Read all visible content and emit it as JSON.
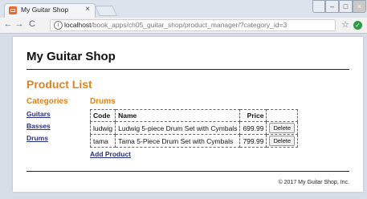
{
  "browser": {
    "tab_title": "My Guitar Shop",
    "tab_close": "×",
    "back": "←",
    "forward": "→",
    "reload": "C",
    "url_host": "localhost",
    "url_path": "/book_apps/ch05_guitar_shop/product_manager/?category_id=3",
    "star": "☆",
    "ext": "✓",
    "menu": "⋮",
    "win_min": "–",
    "win_max": "□",
    "win_close": "×"
  },
  "site": {
    "title": "My Guitar Shop",
    "footer": "© 2017 My Guitar Shop, Inc."
  },
  "page": {
    "title": "Product List",
    "categories_heading": "Categories",
    "categories": [
      {
        "label": "Guitars"
      },
      {
        "label": "Basses"
      },
      {
        "label": "Drums"
      }
    ],
    "selected_category": "Drums",
    "table": {
      "headers": {
        "code": "Code",
        "name": "Name",
        "price": "Price"
      },
      "rows": [
        {
          "code": "ludwig",
          "name": "Ludwig 5-piece Drum Set with Cymbals",
          "price": "699.99",
          "action": "Delete"
        },
        {
          "code": "tama",
          "name": "Tama 5-Piece Drum Set with Cymbals",
          "price": "799.99",
          "action": "Delete"
        }
      ]
    },
    "add_link": "Add Product"
  }
}
